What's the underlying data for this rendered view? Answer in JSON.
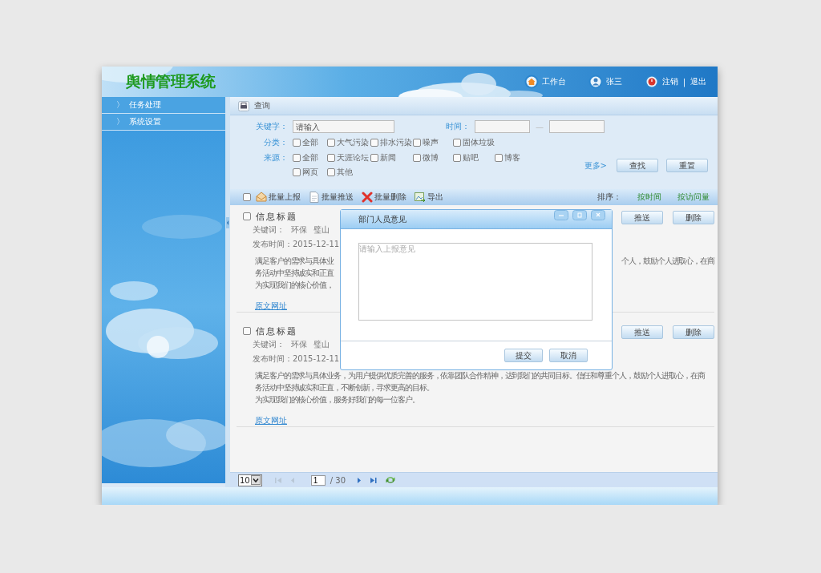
{
  "header": {
    "logo": "舆情管理系统",
    "nav": [
      {
        "kind": "home",
        "label": "工作台"
      },
      {
        "kind": "user",
        "label": "张三"
      }
    ],
    "session": {
      "logout": "注销",
      "separator": "|",
      "exit": "退出"
    }
  },
  "sidebar": {
    "items": [
      {
        "arrow": "〉",
        "label": "任务处理"
      },
      {
        "arrow": "〉",
        "label": "系统设置"
      }
    ]
  },
  "query": {
    "title": "查询",
    "keyword": {
      "label": "关键字：",
      "placeholder": "请输入"
    },
    "time": {
      "label": "时间：",
      "dash": "—"
    },
    "category": {
      "label": "分类：",
      "options": [
        {
          "label": "全部",
          "checked": false
        },
        {
          "label": "大气污染",
          "checked": false
        },
        {
          "label": "排水污染",
          "checked": false
        },
        {
          "label": "噪声",
          "checked": false
        },
        {
          "label": "固体垃圾",
          "checked": false
        }
      ]
    },
    "source": {
      "label": "来源：",
      "options": [
        {
          "label": "全部",
          "checked": false
        },
        {
          "label": "天涯论坛",
          "checked": false
        },
        {
          "label": "新闻",
          "checked": false
        },
        {
          "label": "微博",
          "checked": false
        },
        {
          "label": "贴吧",
          "checked": false
        },
        {
          "label": "博客",
          "checked": false
        },
        {
          "label": "网页",
          "checked": false
        },
        {
          "label": "其他",
          "checked": false
        }
      ]
    },
    "more": "更多>",
    "buttons": [
      "查找",
      "重置"
    ]
  },
  "toolbar": {
    "checked": false,
    "actions": [
      {
        "kind": "report",
        "label": "批量上报"
      },
      {
        "kind": "push",
        "label": "批量推送"
      },
      {
        "kind": "delete",
        "label": "批量删除"
      },
      {
        "kind": "export",
        "label": "导出"
      }
    ],
    "sort_label": "排序：",
    "sort_options": [
      "按时间",
      "按访问量"
    ]
  },
  "items": [
    {
      "checked": false,
      "title": "信息标题",
      "keyword_label": "关键词：",
      "keywords": [
        "环保",
        "璧山"
      ],
      "date_label": "发布时间：",
      "date": "2015-12-11",
      "lines": [
        {
          "left": "满足客户的需求与具体业",
          "right": "个人，鼓励个人进取心，在商"
        },
        {
          "left": "务活动中坚持诚实和正直"
        },
        {
          "left": "为实现我们的核心价值，"
        }
      ],
      "link": "原文网址",
      "buttons": [
        "推送",
        "删除"
      ]
    },
    {
      "checked": false,
      "title": "信息标题",
      "keyword_label": "关键词：",
      "keywords": [
        "环保",
        "璧山"
      ],
      "date_label": "发布时间：",
      "date": "2015-12-11",
      "lines": [
        {
          "left": "满足客户的需求与具体业务，为用户提供优质完善的服务，依靠团队合作精神，达到我们的共同目标。信任和尊重个人，鼓励个人进取心，在商"
        },
        {
          "left": "务活动中坚持诚实和正直，不断创新，寻求更高的目标。"
        },
        {
          "left": "为实现我们的核心价值，服务好我们的每一位客户。"
        }
      ],
      "link": "原文网址",
      "buttons": [
        "推送",
        "删除"
      ]
    }
  ],
  "pager": {
    "page_size": "10",
    "page": "1",
    "total": "/ 30"
  },
  "dialog": {
    "title": "部门人员意见",
    "placeholder": "请输入上报意见",
    "buttons": [
      "提交",
      "取消"
    ]
  }
}
